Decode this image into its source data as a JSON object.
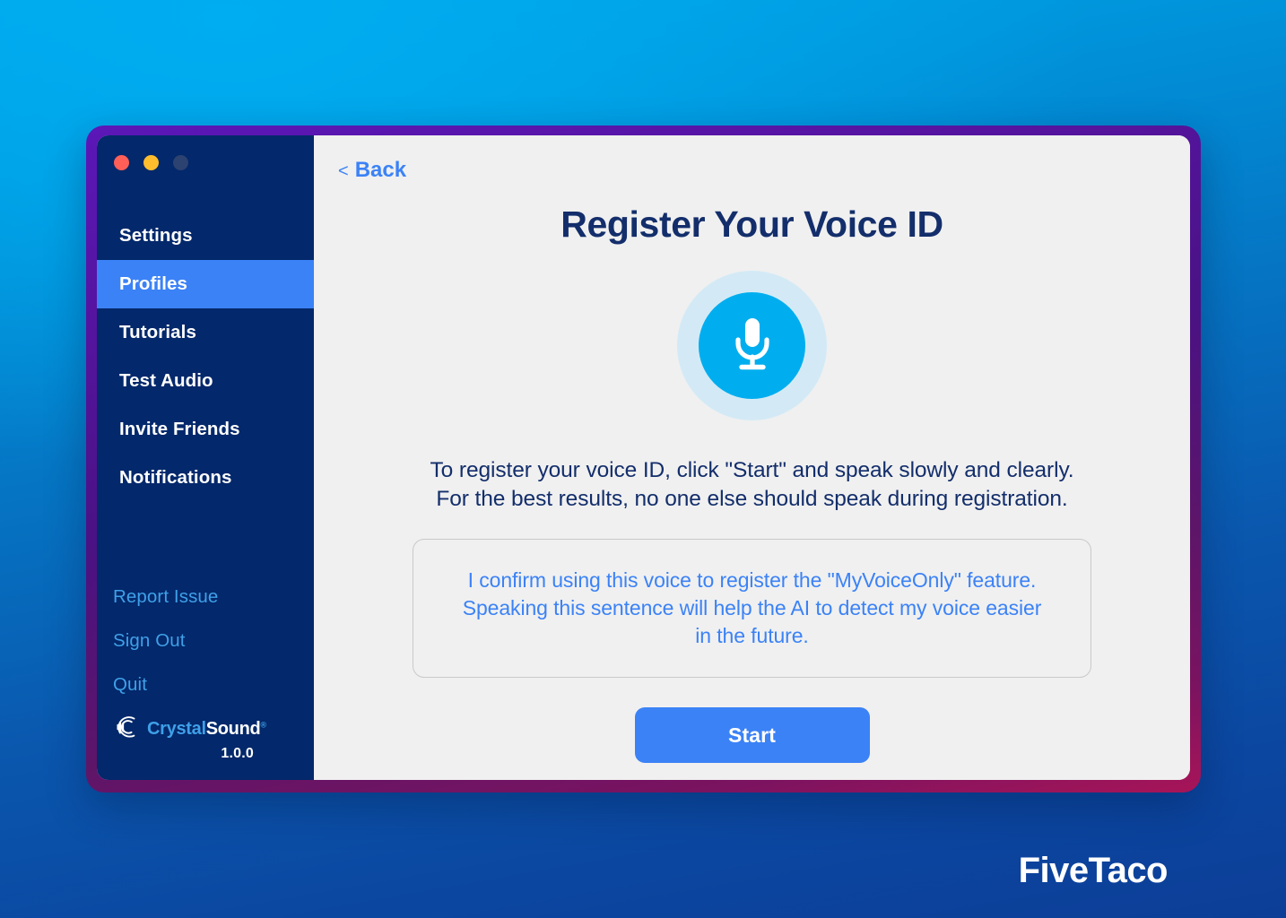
{
  "window": {
    "traffic_lights": [
      {
        "name": "close",
        "color": "#FF5F57"
      },
      {
        "name": "minimize",
        "color": "#FFBD2E"
      },
      {
        "name": "maximize",
        "color": "#2C4270"
      }
    ]
  },
  "sidebar": {
    "nav_items": [
      {
        "label": "Settings",
        "active": false
      },
      {
        "label": "Profiles",
        "active": true
      },
      {
        "label": "Tutorials",
        "active": false
      },
      {
        "label": "Test Audio",
        "active": false
      },
      {
        "label": "Invite Friends",
        "active": false
      },
      {
        "label": "Notifications",
        "active": false
      }
    ],
    "links": [
      {
        "label": "Report Issue"
      },
      {
        "label": "Sign Out"
      },
      {
        "label": "Quit"
      }
    ],
    "brand": {
      "name_part1": "Crystal",
      "name_part2": "Sound",
      "registered_mark": "®",
      "version": "1.0.0",
      "logo_icon": "crystalsound-waves-icon"
    }
  },
  "main": {
    "back": {
      "chevron": "<",
      "label": "Back"
    },
    "title": "Register Your Voice ID",
    "mic_icon": "microphone-icon",
    "instructions_line1": "To register your voice ID, click \"Start\" and speak slowly and clearly.",
    "instructions_line2": "For the best results, no one else should speak during registration.",
    "confirmation_text": "I confirm using this voice to register the \"MyVoiceOnly\" feature. Speaking this sentence will help the AI to detect my voice easier in the future.",
    "start_label": "Start"
  },
  "watermark": {
    "label": "FiveTaco"
  },
  "colors": {
    "accent_blue": "#3B82F6",
    "mic_cyan": "#00AEEF",
    "mic_halo": "#D3EAF6",
    "sidebar_navy": "#03286B",
    "title_navy": "#132E6B",
    "link_blue": "#3FA0E8",
    "panel_bg": "#F0F0F0",
    "frame_purple": "#4A1284"
  }
}
